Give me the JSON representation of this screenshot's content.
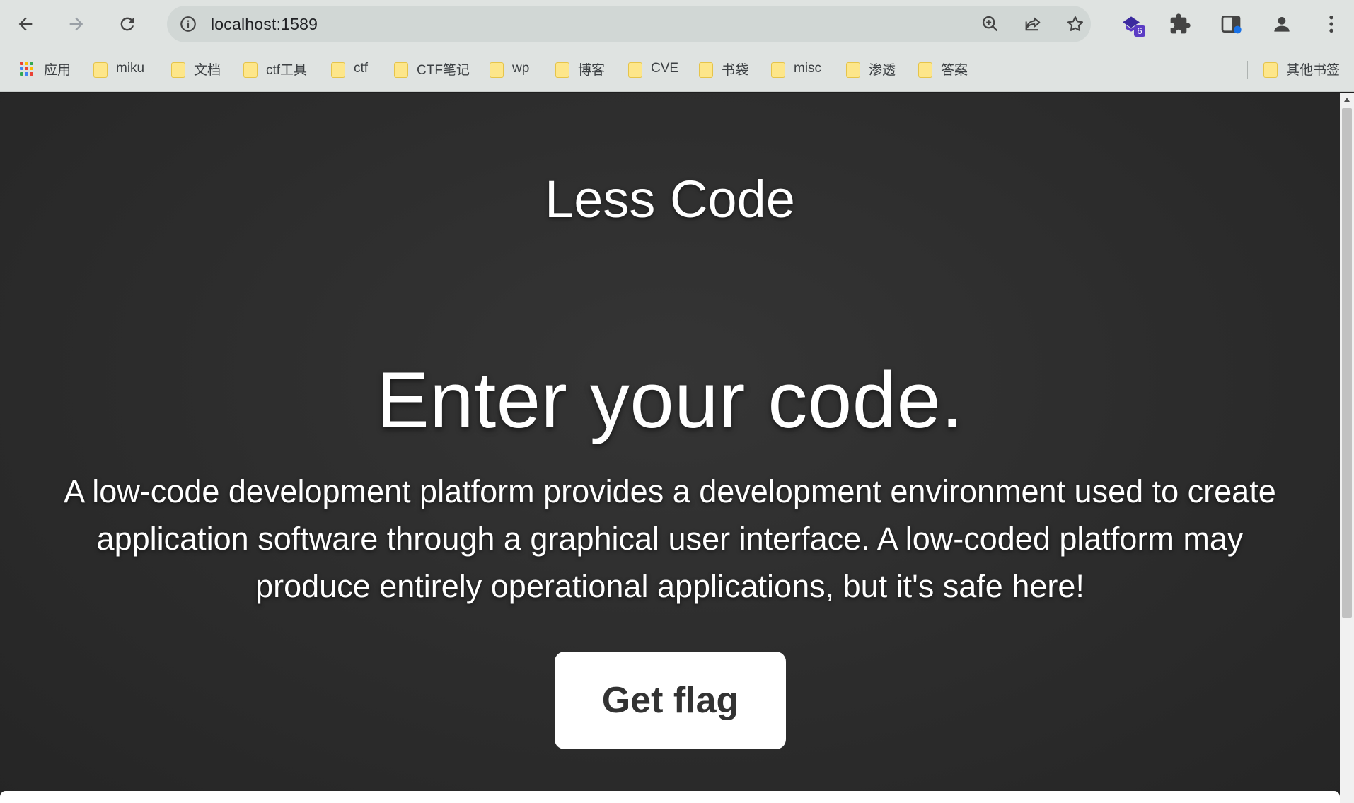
{
  "browser": {
    "url": "localhost:1589",
    "extension_badge": "6"
  },
  "bookmarks": {
    "apps_label": "应用",
    "items": [
      {
        "label": "miku"
      },
      {
        "label": "文档"
      },
      {
        "label": "ctf工具"
      },
      {
        "label": "ctf"
      },
      {
        "label": "CTF笔记"
      },
      {
        "label": "wp"
      },
      {
        "label": "博客"
      },
      {
        "label": "CVE"
      },
      {
        "label": "书袋"
      },
      {
        "label": "misc"
      },
      {
        "label": "渗透"
      },
      {
        "label": "答案"
      }
    ],
    "other_label": "其他书签"
  },
  "page": {
    "site_title": "Less Code",
    "headline": "Enter your code.",
    "lead": "A low-code development platform provides a development environment used to create application software through a graphical user interface. A low-coded platform may produce entirely operational applications, but it's safe here!",
    "cta_label": "Get flag"
  },
  "colors": {
    "chrome_bg": "#dfe3e1",
    "omnibox_bg": "#d1d7d5",
    "page_bg": "#2f2f2f",
    "text": "#ffffff",
    "button_bg": "#ffffff",
    "button_text": "#333333"
  }
}
